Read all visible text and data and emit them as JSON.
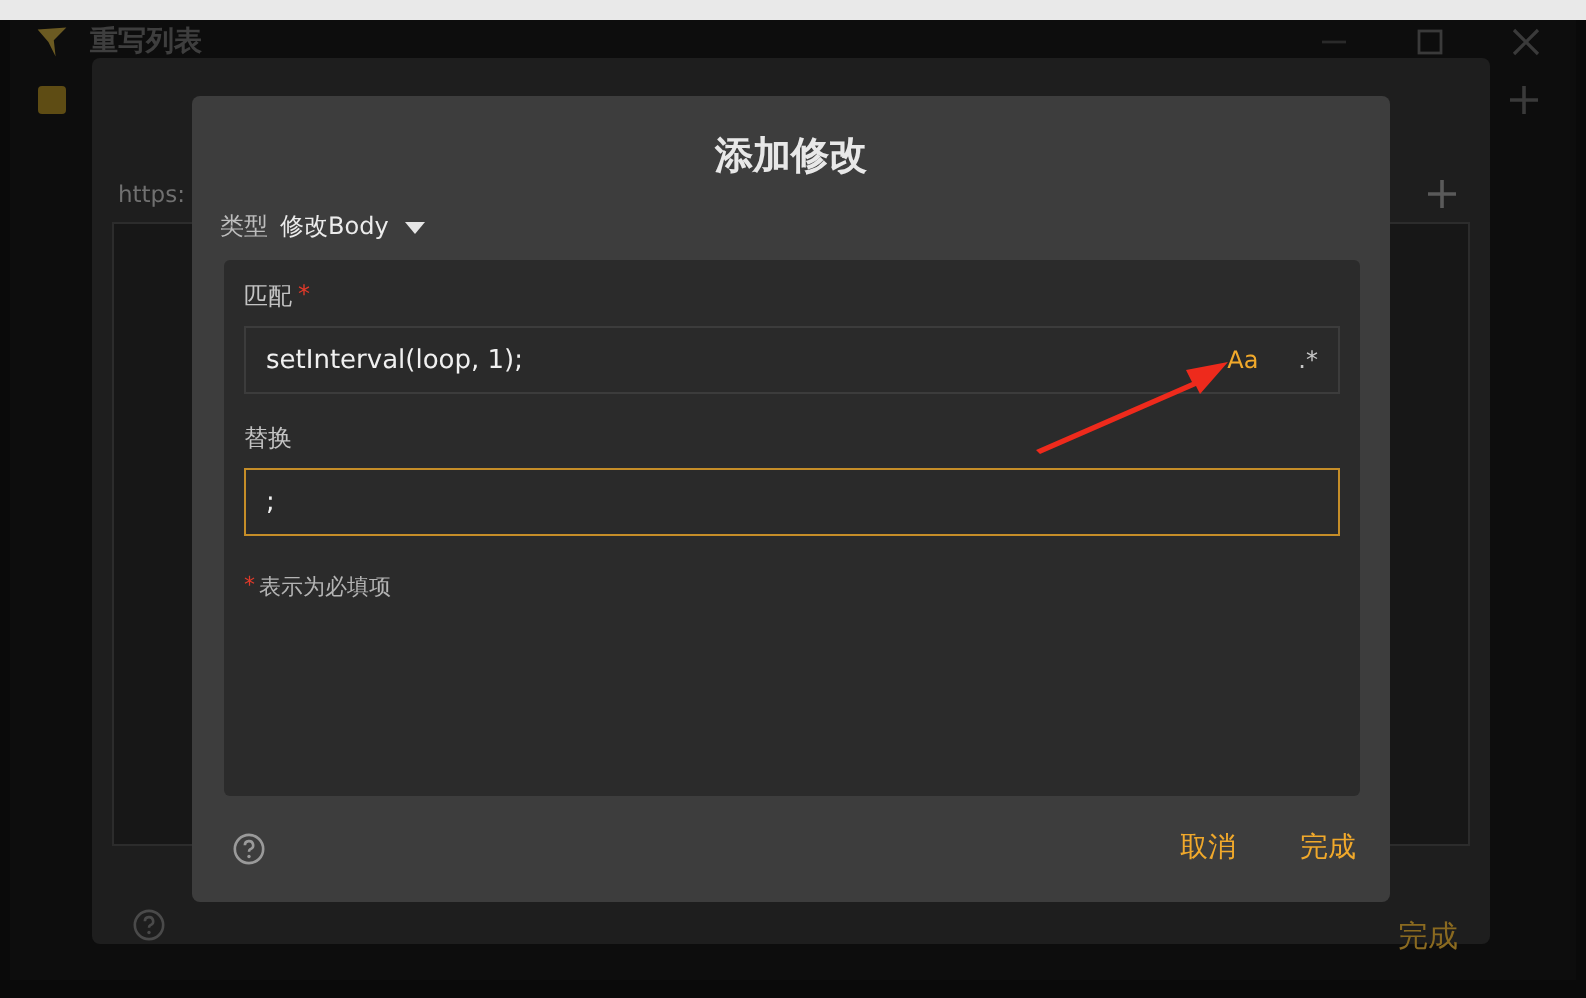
{
  "window": {
    "title": "重写列表"
  },
  "rule_list": {
    "enabled": {
      "checked": true
    },
    "url_fragment": "https:",
    "done": "完成"
  },
  "dialog": {
    "title": "添加修改",
    "type_label": "类型",
    "type_value": "修改Body",
    "required_mark": "*",
    "fields": [
      {
        "label": "匹配",
        "required": true,
        "value": "setInterval(loop, 1);",
        "focused": false,
        "options": [
          {
            "label": "Aa",
            "selected": true
          },
          {
            "label": ".*",
            "selected": false
          }
        ]
      },
      {
        "label": "替换",
        "required": false,
        "value": ";",
        "focused": true
      }
    ],
    "required_note": "表示为必填项",
    "buttons": [
      "取消",
      "完成"
    ]
  }
}
